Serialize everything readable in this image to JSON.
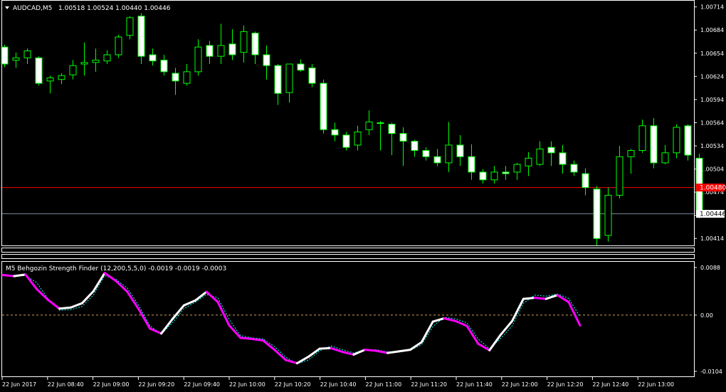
{
  "main": {
    "header": {
      "symbol": "AUDCAD,M5",
      "ohlc": "1.00518 1.00524 1.00440 1.00446"
    },
    "y_ticks": [
      "1.00714",
      "1.00684",
      "1.00654",
      "1.00624",
      "1.00594",
      "1.00564",
      "1.00534",
      "1.00504",
      "1.00474",
      "1.00444",
      "1.00414"
    ],
    "bid_label": "1.00446",
    "ask_label": "1.00480",
    "colors": {
      "up": "#00ff00",
      "down": "#00ff00",
      "body_fill": "#ffffff",
      "ask_line": "#ff0000",
      "bid_line": "#778899",
      "axis": "#ffffff"
    }
  },
  "indicator": {
    "header": "M5 Behgozin Strength Finder (12,200,5,5,0) -0.0019 -0.0019 -0.0003",
    "y_ticks": [
      "0.0088",
      "0.00",
      "-0.0104"
    ],
    "colors": {
      "rising": "#ffffff",
      "falling": "#ff00ff",
      "signal": "#00ffff",
      "zero": "#d2a15a"
    }
  },
  "x_axis": {
    "labels": [
      "22 Jun 2017",
      "22 Jun 08:40",
      "22 Jun 09:00",
      "22 Jun 09:20",
      "22 Jun 09:40",
      "22 Jun 10:00",
      "22 Jun 10:20",
      "22 Jun 10:40",
      "22 Jun 11:00",
      "22 Jun 11:20",
      "22 Jun 11:40",
      "22 Jun 12:00",
      "22 Jun 12:20",
      "22 Jun 12:40",
      "22 Jun 13:00"
    ]
  },
  "chart_data": [
    {
      "type": "candlestick",
      "title": "AUDCAD,M5",
      "ylim": [
        1.00405,
        1.00722
      ],
      "ask": 1.0048,
      "bid": 1.00446,
      "candles": [
        [
          1.00662,
          1.00665,
          1.00636,
          1.0064
        ],
        [
          1.00645,
          1.00655,
          1.00635,
          1.00648
        ],
        [
          1.00648,
          1.0066,
          1.0064,
          1.00657
        ],
        [
          1.00648,
          1.0065,
          1.00612,
          1.00615
        ],
        [
          1.00618,
          1.00625,
          1.00602,
          1.00622
        ],
        [
          1.0062,
          1.00628,
          1.00614,
          1.00625
        ],
        [
          1.00626,
          1.00645,
          1.0062,
          1.00638
        ],
        [
          1.0064,
          1.00668,
          1.00625,
          1.00642
        ],
        [
          1.00642,
          1.0066,
          1.0063,
          1.00645
        ],
        [
          1.00644,
          1.00658,
          1.0064,
          1.00652
        ],
        [
          1.00652,
          1.00678,
          1.00648,
          1.00675
        ],
        [
          1.00677,
          1.00702,
          1.00672,
          1.007
        ],
        [
          1.00702,
          1.00706,
          1.0064,
          1.0065
        ],
        [
          1.00652,
          1.0066,
          1.00638,
          1.00644
        ],
        [
          1.00645,
          1.00652,
          1.00625,
          1.0063
        ],
        [
          1.00628,
          1.00635,
          1.006,
          1.00618
        ],
        [
          1.00615,
          1.0064,
          1.00612,
          1.0063
        ],
        [
          1.0063,
          1.00672,
          1.00625,
          1.00662
        ],
        [
          1.00664,
          1.0067,
          1.0064,
          1.0065
        ],
        [
          1.0065,
          1.00692,
          1.0064,
          1.00664
        ],
        [
          1.00666,
          1.00685,
          1.00645,
          1.00652
        ],
        [
          1.00655,
          1.0069,
          1.00642,
          1.00682
        ],
        [
          1.0068,
          1.00682,
          1.0064,
          1.00652
        ],
        [
          1.00652,
          1.00664,
          1.0062,
          1.00638
        ],
        [
          1.00638,
          1.0064,
          1.00587,
          1.00602
        ],
        [
          1.00603,
          1.0064,
          1.0059,
          1.0064
        ],
        [
          1.0064,
          1.00646,
          1.0063,
          1.00632
        ],
        [
          1.00635,
          1.0064,
          1.0061,
          1.00615
        ],
        [
          1.00615,
          1.0062,
          1.0055,
          1.00555
        ],
        [
          1.00555,
          1.00564,
          1.0054,
          1.00548
        ],
        [
          1.00548,
          1.00552,
          1.00528,
          1.00532
        ],
        [
          1.00535,
          1.0056,
          1.00528,
          1.00552
        ],
        [
          1.00555,
          1.0058,
          1.00548,
          1.00565
        ],
        [
          1.00564,
          1.00566,
          1.00528,
          1.00563
        ],
        [
          1.00562,
          1.00564,
          1.00522,
          1.0055
        ],
        [
          1.0055,
          1.00558,
          1.00508,
          1.0054
        ],
        [
          1.0054,
          1.00542,
          1.0052,
          1.00528
        ],
        [
          1.00528,
          1.00532,
          1.00515,
          1.0052
        ],
        [
          1.0052,
          1.0053,
          1.00508,
          1.00512
        ],
        [
          1.00512,
          1.00565,
          1.005,
          1.00535
        ],
        [
          1.00535,
          1.00548,
          1.00508,
          1.0052
        ],
        [
          1.0052,
          1.00536,
          1.0049,
          1.005
        ],
        [
          1.005,
          1.00504,
          1.00485,
          1.0049
        ],
        [
          1.0049,
          1.00508,
          1.00485,
          1.005
        ],
        [
          1.005,
          1.00508,
          1.0049,
          1.00498
        ],
        [
          1.005,
          1.00512,
          1.0049,
          1.0051
        ],
        [
          1.00508,
          1.00526,
          1.00495,
          1.00518
        ],
        [
          1.0051,
          1.0054,
          1.00508,
          1.0053
        ],
        [
          1.00532,
          1.0054,
          1.00508,
          1.00525
        ],
        [
          1.00525,
          1.00535,
          1.00498,
          1.0051
        ],
        [
          1.0051,
          1.00515,
          1.00495,
          1.005
        ],
        [
          1.00498,
          1.00505,
          1.0047,
          1.0048
        ],
        [
          1.00478,
          1.00482,
          1.00405,
          1.00414
        ],
        [
          1.00418,
          1.0048,
          1.0041,
          1.0047
        ],
        [
          1.0047,
          1.00534,
          1.00466,
          1.0052
        ],
        [
          1.0052,
          1.0053,
          1.00498,
          1.00528
        ],
        [
          1.00528,
          1.00568,
          1.00525,
          1.0056
        ],
        [
          1.0056,
          1.0057,
          1.00505,
          1.00512
        ],
        [
          1.00512,
          1.00535,
          1.0051,
          1.00525
        ],
        [
          1.00525,
          1.00562,
          1.00518,
          1.00558
        ],
        [
          1.0056,
          1.00562,
          1.00515,
          1.00522
        ],
        [
          1.00518,
          1.00524,
          1.0044,
          1.00446
        ]
      ]
    },
    {
      "type": "line",
      "title": "M5 Behgozin Strength Finder (12,200,5,5,0)",
      "ylim": [
        -0.0104,
        0.0088
      ],
      "series": [
        {
          "values": [
            0.0074,
            0.0072,
            0.0075,
            0.0048,
            0.0028,
            0.0012,
            0.0014,
            0.0022,
            0.0044,
            0.0078,
            0.0063,
            0.0043,
            0.0011,
            -0.0025,
            -0.0034,
            -0.0007,
            0.0018,
            0.0027,
            0.0043,
            0.0024,
            -0.0019,
            -0.0042,
            -0.0044,
            -0.0047,
            -0.0064,
            -0.0083,
            -0.0089,
            -0.0077,
            -0.0062,
            -0.0061,
            -0.0068,
            -0.0073,
            -0.0064,
            -0.0066,
            -0.007,
            -0.0067,
            -0.0064,
            -0.005,
            -0.0012,
            -0.0006,
            -0.0011,
            -0.002,
            -0.0053,
            -0.0065,
            -0.0036,
            -0.0011,
            0.003,
            0.0032,
            0.003,
            0.0037,
            0.0024,
            -0.0019
          ]
        },
        {
          "values": [
            0.0074,
            0.0073,
            0.0073,
            0.006,
            0.003,
            0.0009,
            0.001,
            0.0016,
            0.0037,
            0.0073,
            0.0066,
            0.005,
            0.0018,
            -0.002,
            -0.0035,
            -0.0014,
            0.0012,
            0.0024,
            0.0038,
            0.0032,
            -0.0008,
            -0.0038,
            -0.0042,
            -0.0044,
            -0.0058,
            -0.0078,
            -0.009,
            -0.0083,
            -0.0066,
            -0.0057,
            -0.0064,
            -0.007,
            -0.0064,
            -0.0064,
            -0.0068,
            -0.0067,
            -0.0065,
            -0.0055,
            -0.0021,
            -0.0004,
            -0.0007,
            -0.0014,
            -0.0044,
            -0.0062,
            -0.0043,
            -0.002,
            0.0022,
            0.0037,
            0.0035,
            0.0039,
            0.0031,
            -0.0003
          ]
        }
      ]
    }
  ]
}
